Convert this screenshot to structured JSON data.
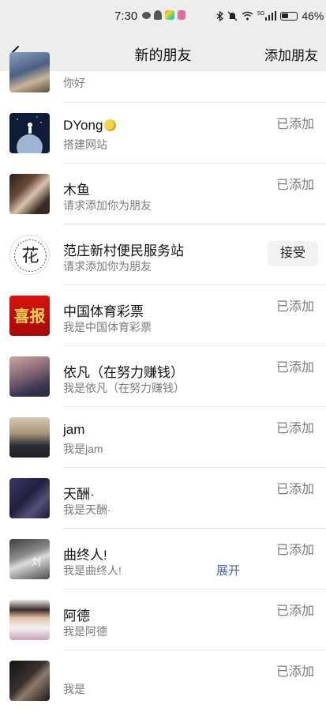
{
  "status_bar": {
    "time": "7:30",
    "network": "5G",
    "battery_percent": "46%"
  },
  "nav": {
    "title": "新的朋友",
    "action": "添加朋友"
  },
  "friends": [
    {
      "name": "",
      "message": "你好",
      "status": ""
    },
    {
      "name": "DYong",
      "message": "搭建网站",
      "status": "已添加"
    },
    {
      "name": "木鱼",
      "message": "请求添加你为朋友",
      "status": "已添加"
    },
    {
      "name": "范庄新村便民服务站",
      "message": "请求添加你为朋友",
      "action": "接受"
    },
    {
      "name": "中国体育彩票",
      "message": "我是中国体育彩票",
      "status": "已添加"
    },
    {
      "name": "依凡（在努力赚钱）",
      "message": "我是依凡（在努力赚钱）",
      "status": "已添加"
    },
    {
      "name": "jam",
      "message": "我是jam",
      "status": "已添加"
    },
    {
      "name": "天酬·",
      "message": "我是天酬·",
      "status": "已添加"
    },
    {
      "name": "曲终人!",
      "message": "我是曲终人!",
      "status": "已添加",
      "expand": "展开"
    },
    {
      "name": "阿德",
      "message": "我是阿德",
      "status": "已添加"
    },
    {
      "name": "",
      "message": "我是",
      "status": "已添加"
    }
  ],
  "avatar_texts": {
    "lottery": "喜报",
    "service_station": "花",
    "qu_zhong_ren": "刘"
  }
}
